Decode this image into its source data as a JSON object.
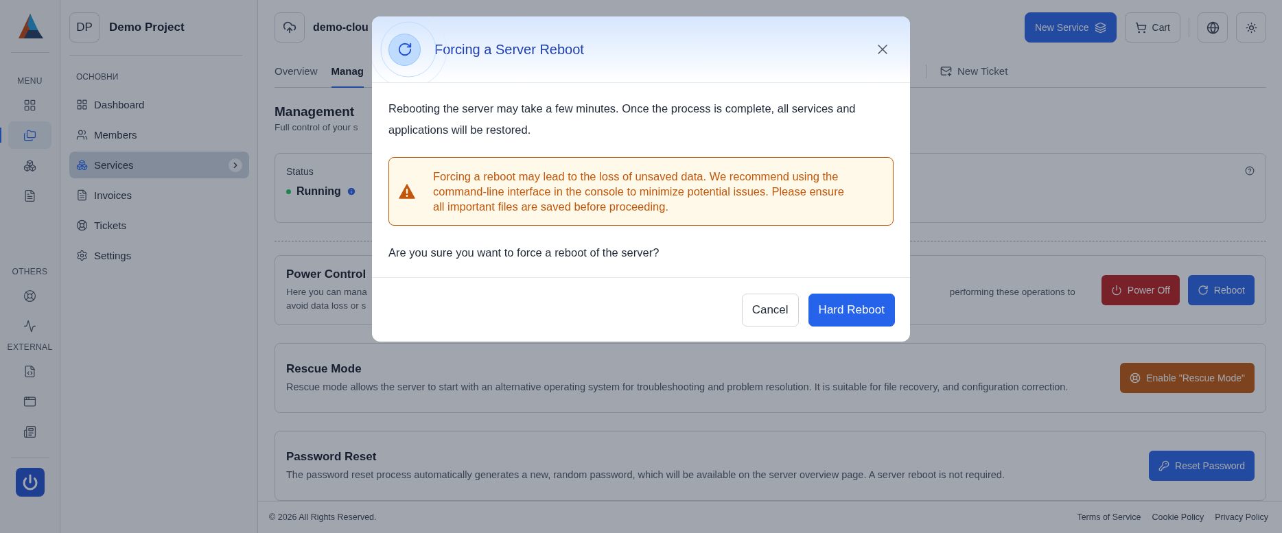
{
  "rail": {
    "sections": [
      {
        "label": "MENU",
        "items": [
          {
            "selected": false
          },
          {
            "selected": true
          },
          {
            "selected": false
          },
          {
            "selected": false
          }
        ]
      },
      {
        "label": "OTHERS",
        "items": [
          {
            "selected": false
          },
          {
            "selected": false
          }
        ]
      },
      {
        "label": "EXTERNAL",
        "items": [
          {
            "selected": false
          },
          {
            "selected": false
          },
          {
            "selected": false
          }
        ]
      }
    ]
  },
  "sidebar": {
    "project": {
      "initials": "DP",
      "name": "Demo Project"
    },
    "section_label": "ОСНОВНИ",
    "items": [
      {
        "label": "Dashboard",
        "selected": false
      },
      {
        "label": "Members",
        "selected": false
      },
      {
        "label": "Services",
        "selected": true
      },
      {
        "label": "Invoices",
        "selected": false
      },
      {
        "label": "Tickets",
        "selected": false
      },
      {
        "label": "Settings",
        "selected": false
      }
    ]
  },
  "header": {
    "service_name": "demo-clou",
    "buttons": [
      {
        "label": "New Service",
        "kind": "primary"
      },
      {
        "label": "Cart",
        "kind": "outline"
      }
    ]
  },
  "tabs": [
    {
      "label": "Overview",
      "selected": false,
      "kind": "plain"
    },
    {
      "label": "Manag",
      "selected": true,
      "kind": "plain"
    },
    {
      "label": "New Ticket",
      "selected": false,
      "kind": "ticket"
    }
  ],
  "page": {
    "title": "Management",
    "subtitle": "Full control of your s",
    "status": {
      "label": "Status",
      "value": "Running"
    },
    "cards": [
      {
        "title": "Power Control",
        "description_left": [
          "Here you can mana",
          "avoid data loss or s"
        ],
        "description_right": "performing these operations to",
        "buttons": [
          {
            "label": "Power Off",
            "kind": "danger"
          },
          {
            "label": "Reboot",
            "kind": "primary"
          }
        ]
      },
      {
        "title": "Rescue Mode",
        "description": "Rescue mode allows the server to start with an alternative operating system for troubleshooting and problem resolution. It is suitable for file recovery, and configuration correction.",
        "buttons": [
          {
            "label": "Enable \"Rescue Mode\"",
            "kind": "warning"
          }
        ]
      },
      {
        "title": "Password Reset",
        "description": "The password reset process automatically generates a new, random password, which will be available on the server overview page. A server reboot is not required.",
        "buttons": [
          {
            "label": "Reset Password",
            "kind": "key"
          }
        ]
      }
    ]
  },
  "footer": {
    "copyright": "© 2026 All Rights Reserved.",
    "links": [
      "Terms of Service",
      "Cookie Policy",
      "Privacy Policy"
    ]
  },
  "modal": {
    "title": "Forcing a Server Reboot",
    "body": "Rebooting the server may take a few minutes. Once the process is complete, all services and applications will be restored.",
    "alert": "Forcing a reboot may lead to the loss of unsaved data. We recommend using the command-line interface in the console to minimize potential issues. Please ensure all important files are saved before proceeding.",
    "question": "Are you sure you want to force a reboot of the server?",
    "buttons": [
      {
        "label": "Cancel",
        "kind": "secondary"
      },
      {
        "label": "Hard Reboot",
        "kind": "primary"
      }
    ]
  }
}
